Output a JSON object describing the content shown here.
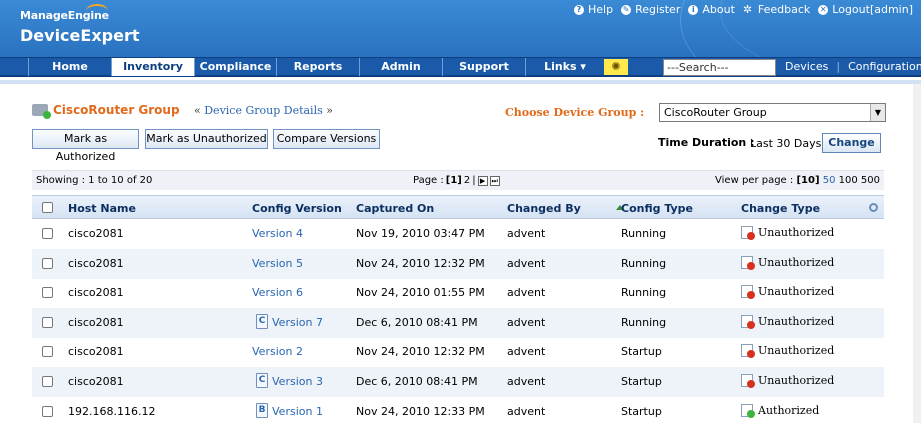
{
  "brand": {
    "top": "ManageEngine",
    "product": "DeviceExpert"
  },
  "toplinks": [
    {
      "label": "Help",
      "icon": "help-icon"
    },
    {
      "label": "Register",
      "icon": "register-icon"
    },
    {
      "label": "About",
      "icon": "about-icon"
    },
    {
      "label": "Feedback",
      "icon": "feedback-icon"
    },
    {
      "label": "Logout[admin]",
      "icon": "logout-icon"
    }
  ],
  "nav": {
    "tabs": [
      "Home",
      "Inventory",
      "Compliance",
      "Reports",
      "Admin",
      "Support",
      "Links ▾"
    ],
    "active": "Inventory",
    "search_placeholder": "---Search---",
    "right": [
      "Devices",
      "Configurations"
    ]
  },
  "group": {
    "name": "CiscoRouter Group",
    "details_link": "Device Group Details",
    "choose_label": "Choose Device Group :",
    "selected": "CiscoRouter Group"
  },
  "buttons": {
    "authorized": "Mark as Authorized",
    "unauthorized": "Mark as Unauthorized",
    "compare": "Compare Versions",
    "change": "Change"
  },
  "time": {
    "label": "Time Duration",
    "colon": ":",
    "value": "Last 30 Days"
  },
  "pager": {
    "showing": "Showing : 1 to 10 of 20",
    "page_label": "Page :",
    "current": "[1]",
    "next_page": "2",
    "sep": "|",
    "view_label": "View per page :",
    "view_current": "[10]",
    "view_options": [
      "50",
      "100",
      "500"
    ]
  },
  "columns": [
    "Host Name",
    "Config Version",
    "Captured On",
    "Changed By",
    "Config Type",
    "Change Type"
  ],
  "rows": [
    {
      "host": "cisco2081",
      "version": "Version 4",
      "captured": "Nov 19, 2010 03:47 PM",
      "by": "advent",
      "type": "Running",
      "change": "Unauthorized",
      "ver_icon": ""
    },
    {
      "host": "cisco2081",
      "version": "Version 5",
      "captured": "Nov 24, 2010 12:32 PM",
      "by": "advent",
      "type": "Running",
      "change": "Unauthorized",
      "ver_icon": ""
    },
    {
      "host": "cisco2081",
      "version": "Version 6",
      "captured": "Nov 24, 2010 01:55 PM",
      "by": "advent",
      "type": "Running",
      "change": "Unauthorized",
      "ver_icon": ""
    },
    {
      "host": "cisco2081",
      "version": "Version 7",
      "captured": "Dec 6, 2010 08:41 PM",
      "by": "advent",
      "type": "Running",
      "change": "Unauthorized",
      "ver_icon": "C"
    },
    {
      "host": "cisco2081",
      "version": "Version 2",
      "captured": "Nov 24, 2010 12:32 PM",
      "by": "advent",
      "type": "Startup",
      "change": "Unauthorized",
      "ver_icon": ""
    },
    {
      "host": "cisco2081",
      "version": "Version 3",
      "captured": "Dec 6, 2010 08:41 PM",
      "by": "advent",
      "type": "Startup",
      "change": "Unauthorized",
      "ver_icon": "C"
    },
    {
      "host": "192.168.116.12",
      "version": "Version 1",
      "captured": "Nov 24, 2010 12:33 PM",
      "by": "advent",
      "type": "Startup",
      "change": "Authorized",
      "ver_icon": "B"
    }
  ],
  "colors": {
    "unauthorized": "#d8301e",
    "authorized": "#3db43d",
    "link": "#2a66b0",
    "accent": "#e06a1a"
  }
}
